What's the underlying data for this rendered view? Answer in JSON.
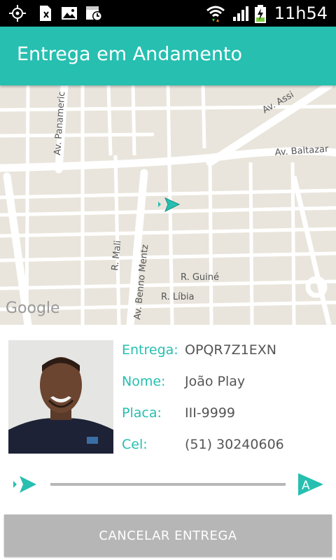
{
  "status_bar": {
    "time": "11h54",
    "icons": [
      "gps-icon",
      "sim-alert-icon",
      "image-icon",
      "calendar-clock-icon",
      "wifi-icon",
      "signal-icon",
      "battery-charging-icon"
    ]
  },
  "app_bar": {
    "title": "Entrega em Andamento"
  },
  "map": {
    "streets": [
      "Av. Panamericana",
      "Av. Assis",
      "Av. Baltazar",
      "R. Mali",
      "Av. Benno Mentz",
      "R. Guiné",
      "R. Líbia"
    ],
    "street_labels_visible": [
      "Av. Panameric",
      "Av. Assi",
      "Av. Baltazar",
      "R. Mali",
      "Av. Benno Mentz",
      "R. Guiné",
      "R. Líbia"
    ],
    "watermark": "Google",
    "marker_icon": "delivery-position-arrow-icon"
  },
  "delivery": {
    "fields": [
      {
        "label": "Entrega:",
        "value": "OPQR7Z1EXN"
      },
      {
        "label": "Nome:",
        "value": "João Play"
      },
      {
        "label": "Placa:",
        "value": "III-9999"
      },
      {
        "label": "Cel:",
        "value": "(51) 30240606"
      }
    ]
  },
  "progress": {
    "start_icon": "courier-arrow-icon",
    "end_icon": "destination-a-icon",
    "end_label": "A",
    "fraction": 0.0
  },
  "actions": {
    "cancel_label": "CANCELAR ENTREGA"
  },
  "colors": {
    "accent": "#26bfb0",
    "app_bar": "#26bfb0",
    "cancel_button": "#b6b6b6",
    "status_bar": "#000000"
  }
}
